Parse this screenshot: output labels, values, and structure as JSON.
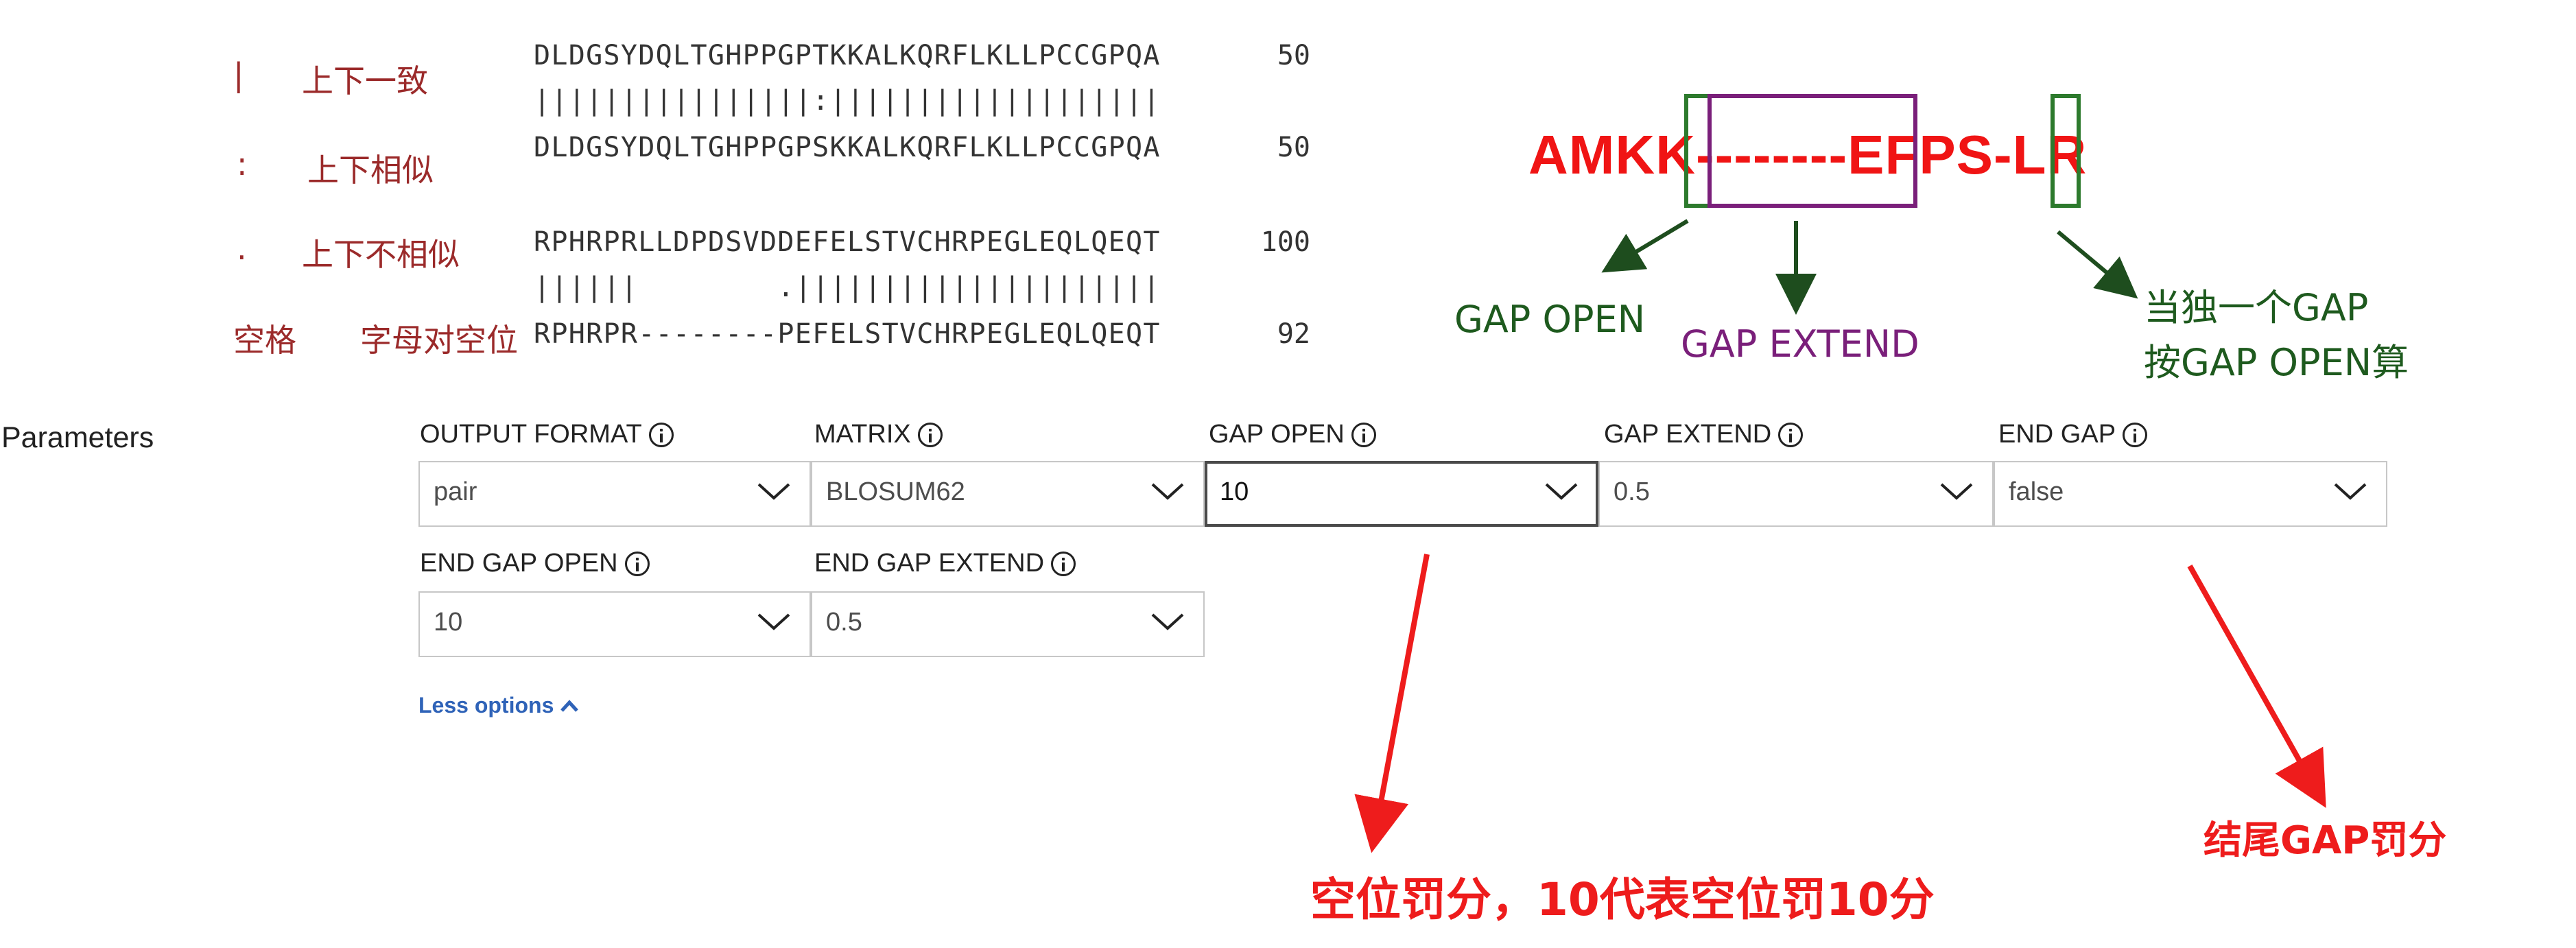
{
  "legend": [
    {
      "symbol": "|",
      "label": "上下一致"
    },
    {
      "symbol": ":",
      "label": "上下相似"
    },
    {
      "symbol": ".",
      "label": "上下不相似"
    },
    {
      "symbol": "空格",
      "label": "字母对空位"
    }
  ],
  "alignment": {
    "block1": {
      "seq_a": "DLDGSYDQLTGHPPGPTKKALKQRFLKLLPCCGPQA",
      "match": "||||||||||||||||:|||||||||||||||||||",
      "seq_b": "DLDGSYDQLTGHPPGPSKKALKQRFLKLLPCCGPQA",
      "num_a": "50",
      "num_b": "50"
    },
    "block2": {
      "seq_a": "RPHRPRLLDPDSVDDEFELSTVCHRPEGLEQLQEQT",
      "match": "||||||        .|||||||||||||||||||||",
      "seq_b": "RPHRPR--------PEFELSTVCHRPEGLEQLQEQT",
      "num_a": "100",
      "num_b": "92"
    }
  },
  "gap_diagram": {
    "sequence": "AMKK--------EFPS-LR",
    "gap_open_label": "GAP OPEN",
    "gap_extend_label": "GAP EXTEND",
    "single_gap_note_line1": "当独一个GAP",
    "single_gap_note_line2": "按GAP OPEN算",
    "green": "#2d7a2d",
    "purple": "#7a1f7a",
    "red": "#f01414"
  },
  "parameters": {
    "title": "Parameters",
    "fields": {
      "output_format": {
        "label": "OUTPUT FORMAT",
        "value": "pair"
      },
      "matrix": {
        "label": "MATRIX",
        "value": "BLOSUM62"
      },
      "gap_open": {
        "label": "GAP OPEN",
        "value": "10"
      },
      "gap_extend": {
        "label": "GAP EXTEND",
        "value": "0.5"
      },
      "end_gap": {
        "label": "END GAP",
        "value": "false"
      },
      "end_gap_open": {
        "label": "END GAP OPEN",
        "value": "10"
      },
      "end_gap_extend": {
        "label": "END GAP EXTEND",
        "value": "0.5"
      }
    },
    "less_options": "Less options",
    "info_icon": "info-icon",
    "chevron_icon": "chevron-down-icon",
    "link_color": "#2f63b8"
  },
  "annotations": {
    "gap_penalty": "空位罚分，10代表空位罚10分",
    "end_gap_penalty": "结尾GAP罚分",
    "color": "#ee1c1c"
  }
}
